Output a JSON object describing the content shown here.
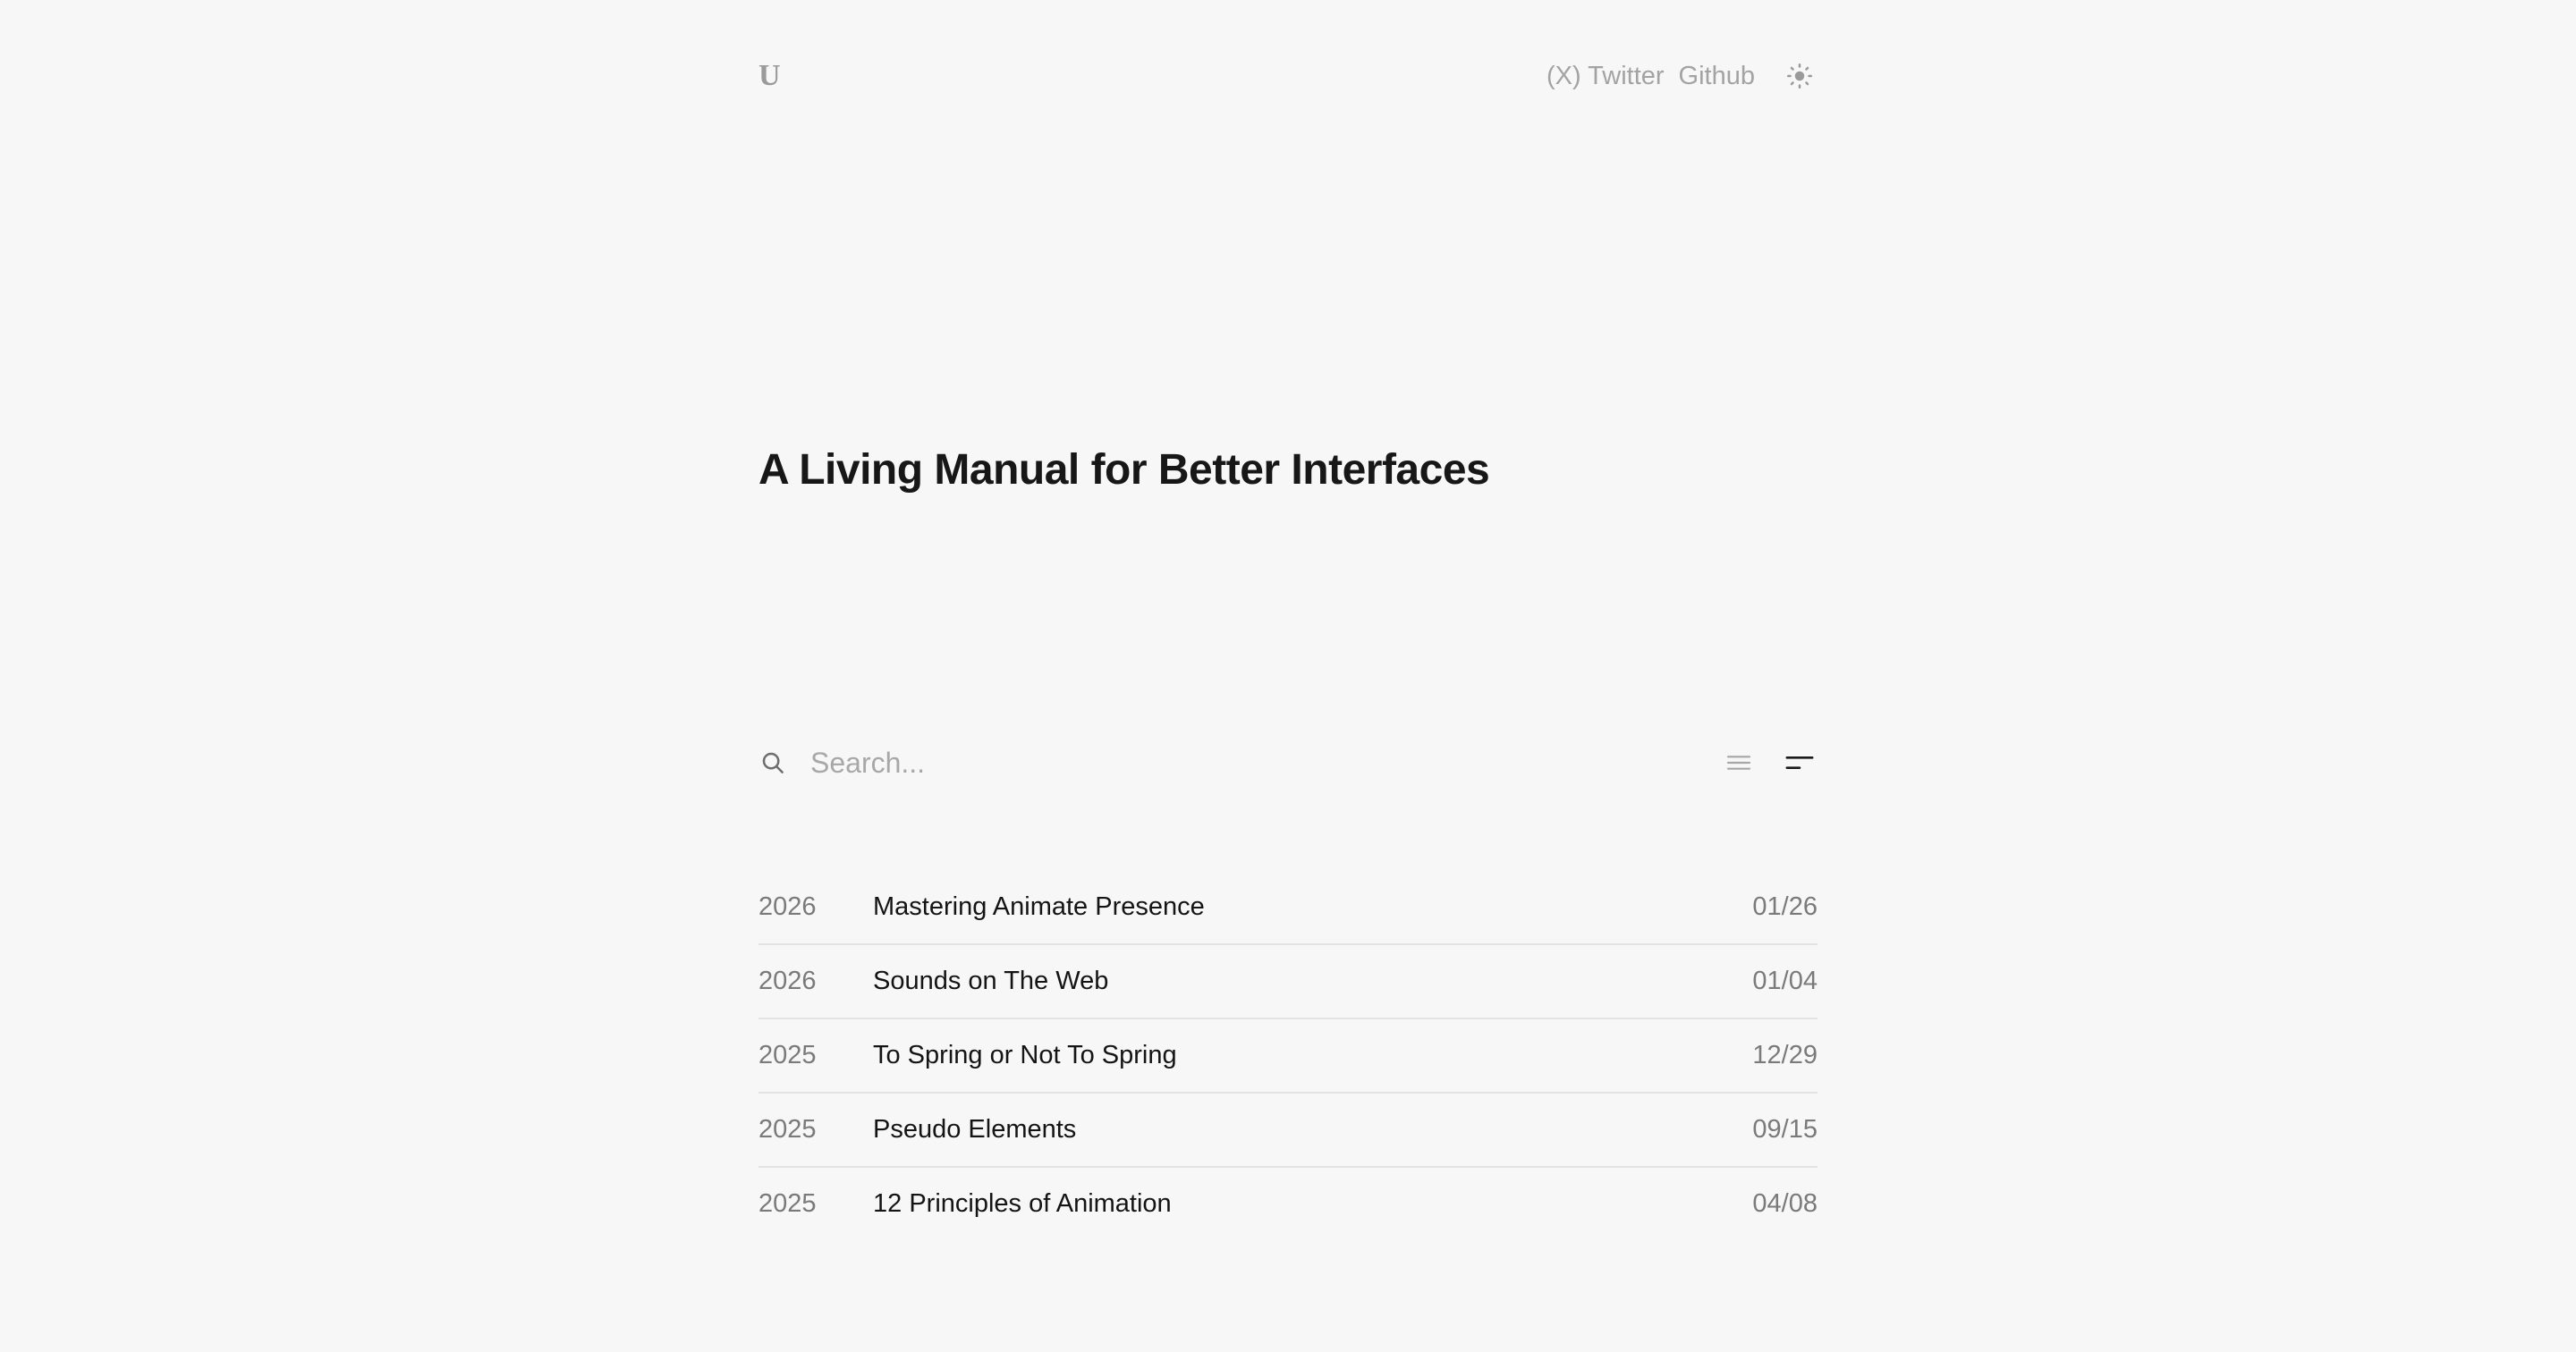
{
  "header": {
    "logo": "U",
    "links": [
      {
        "label": "(X) Twitter"
      },
      {
        "label": "Github"
      }
    ],
    "theme_icon": "sun-icon"
  },
  "main": {
    "title": "A Living Manual for Better Interfaces"
  },
  "search": {
    "placeholder": "Search...",
    "value": "",
    "icon": "search-icon"
  },
  "view_toggle": {
    "options": [
      "list-view-icon",
      "compact-view-icon"
    ],
    "active": "compact-view-icon"
  },
  "posts": [
    {
      "year": "2026",
      "title": "Mastering Animate Presence",
      "date": "01/26"
    },
    {
      "year": "2026",
      "title": "Sounds on The Web",
      "date": "01/04"
    },
    {
      "year": "2025",
      "title": "To Spring or Not To Spring",
      "date": "12/29"
    },
    {
      "year": "2025",
      "title": "Pseudo Elements",
      "date": "09/15"
    },
    {
      "year": "2025",
      "title": "12 Principles of Animation",
      "date": "04/08"
    }
  ],
  "colors": {
    "background": "#f7f7f7",
    "muted_text": "#a3a3a3",
    "primary_text": "#171717",
    "divider": "#e3e3e3"
  }
}
